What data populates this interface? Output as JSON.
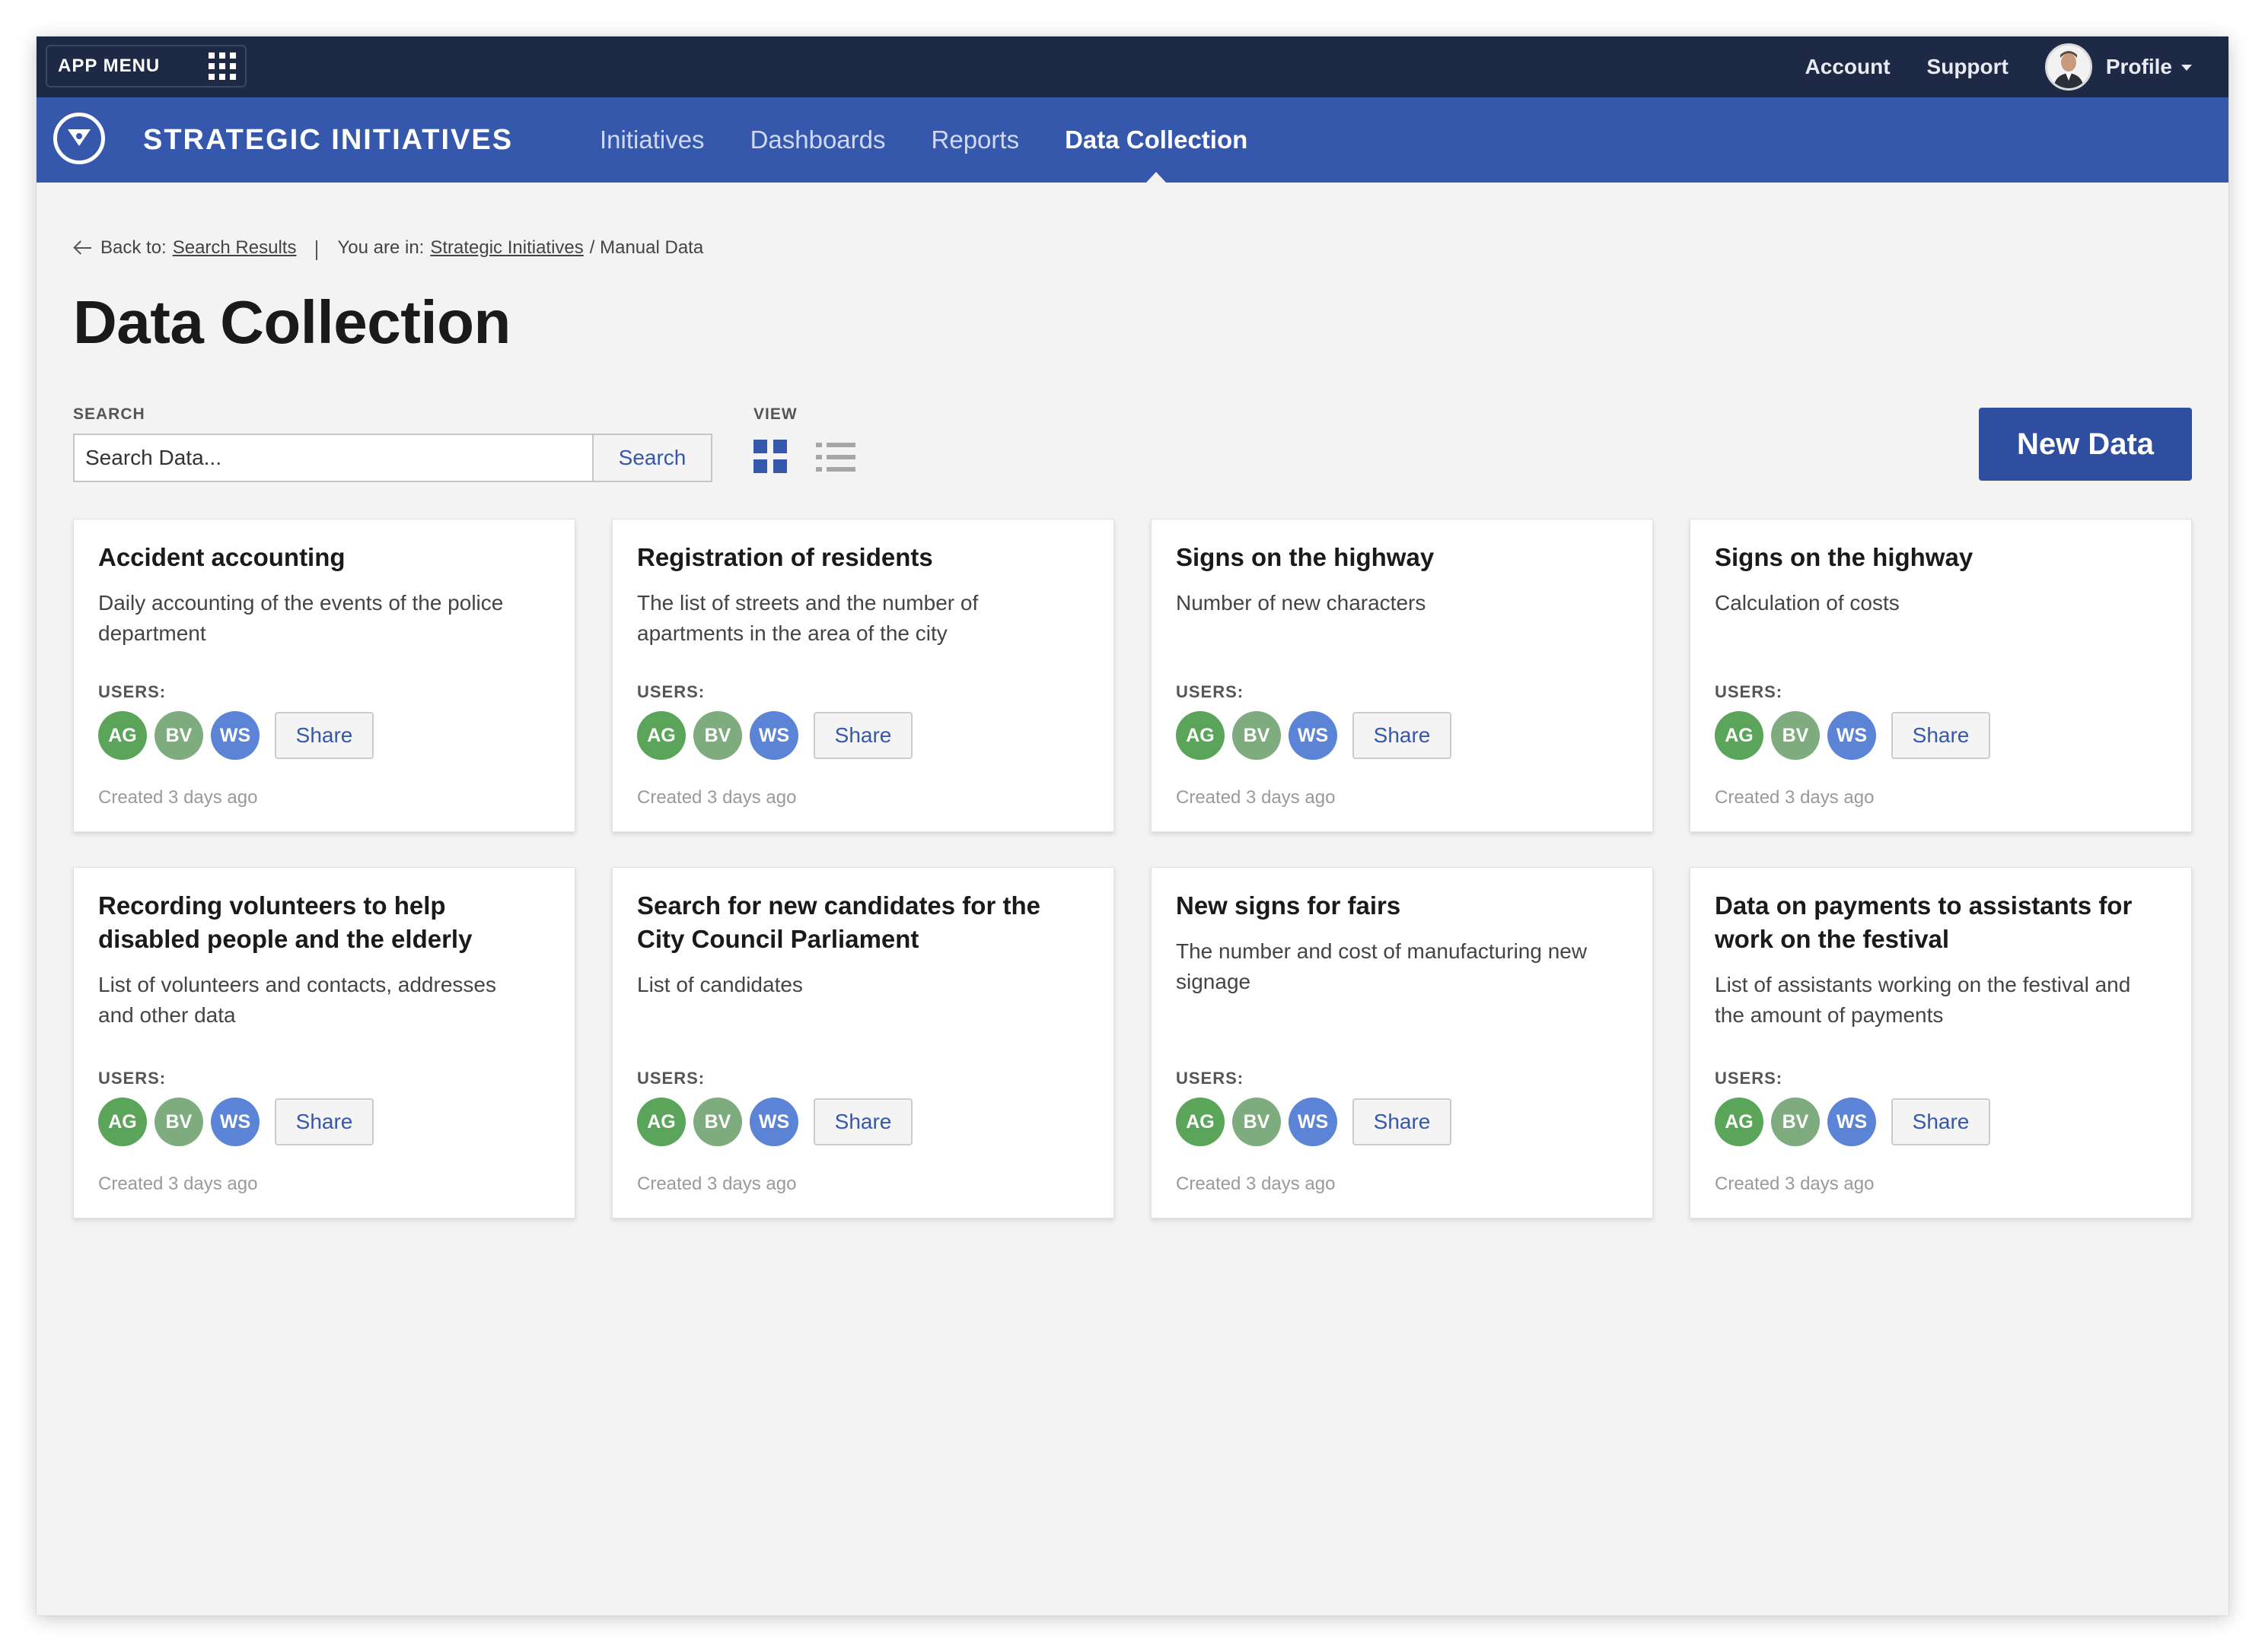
{
  "topbar": {
    "app_menu_label": "APP MENU",
    "links": [
      "Account",
      "Support"
    ],
    "profile_label": "Profile"
  },
  "navbar": {
    "brand": "STRATEGIC INITIATIVES",
    "items": [
      {
        "label": "Initiatives",
        "active": false
      },
      {
        "label": "Dashboards",
        "active": false
      },
      {
        "label": "Reports",
        "active": false
      },
      {
        "label": "Data Collection",
        "active": true
      }
    ],
    "bg_color": "#3558ac",
    "topbar_color": "#1e2a45"
  },
  "breadcrumb": {
    "back_prefix": "Back to:",
    "back_link": "Search Results",
    "location_prefix": "You are in:",
    "location_link": "Strategic Initiatives",
    "location_rest": "/ Manual Data"
  },
  "page": {
    "title": "Data Collection"
  },
  "search": {
    "label": "SEARCH",
    "placeholder": "Search Data...",
    "value": "",
    "button_label": "Search"
  },
  "view": {
    "label": "VIEW",
    "selected": "grid"
  },
  "new_data_label": "New Data",
  "users_label": "USERS:",
  "share_label": "Share",
  "user_colors": {
    "AG": "#5aa55a",
    "BV": "#7fac7f",
    "WS": "#5b84d6"
  },
  "cards": [
    {
      "title": "Accident accounting",
      "description": "Daily accounting of the events of the police department",
      "users": [
        "AG",
        "BV",
        "WS"
      ],
      "created": "Created 3 days ago"
    },
    {
      "title": "Registration of residents",
      "description": "The list of streets and the number of apartments in the area of the city",
      "users": [
        "AG",
        "BV",
        "WS"
      ],
      "created": "Created 3 days ago"
    },
    {
      "title": "Signs on the highway",
      "description": "Number of new characters",
      "users": [
        "AG",
        "BV",
        "WS"
      ],
      "created": "Created 3 days ago"
    },
    {
      "title": "Signs on the highway",
      "description": "Calculation of costs",
      "users": [
        "AG",
        "BV",
        "WS"
      ],
      "created": "Created 3 days ago"
    },
    {
      "title": "Recording volunteers to help disabled people and the elderly",
      "description": "List of volunteers and contacts, addresses and other data",
      "users": [
        "AG",
        "BV",
        "WS"
      ],
      "created": "Created 3 days ago"
    },
    {
      "title": "Search for new candidates for the City Council Parliament",
      "description": "List of candidates",
      "users": [
        "AG",
        "BV",
        "WS"
      ],
      "created": "Created 3 days ago"
    },
    {
      "title": "New signs for fairs",
      "description": "The number and cost of manufacturing new signage",
      "users": [
        "AG",
        "BV",
        "WS"
      ],
      "created": "Created 3 days ago"
    },
    {
      "title": "Data on payments to assistants for work on the festival",
      "description": "List of assistants working on the festival and the amount of payments",
      "users": [
        "AG",
        "BV",
        "WS"
      ],
      "created": "Created 3 days ago"
    }
  ]
}
